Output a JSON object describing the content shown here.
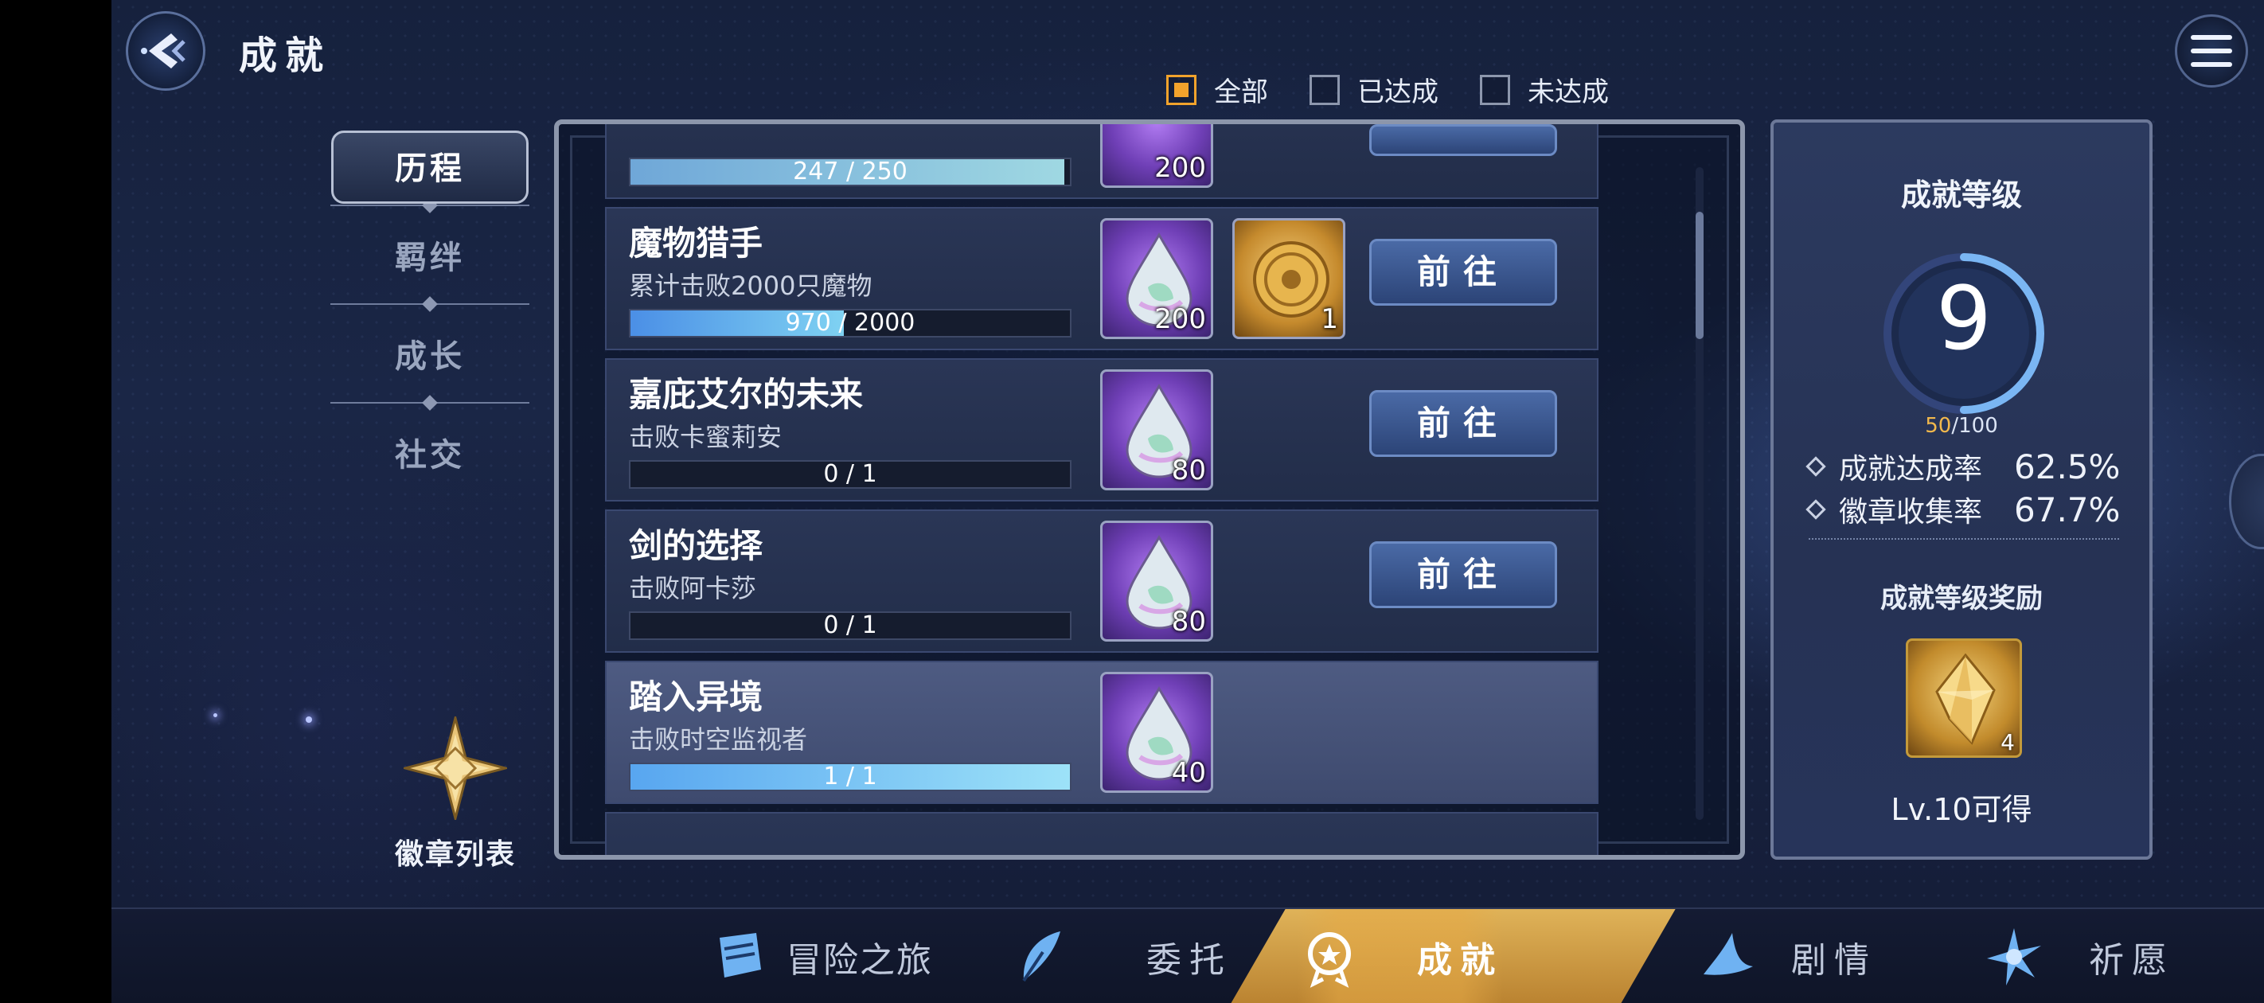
{
  "header": {
    "title": "成就"
  },
  "filters": [
    {
      "label": "全部",
      "checked": true
    },
    {
      "label": "已达成",
      "checked": false
    },
    {
      "label": "未达成",
      "checked": false
    }
  ],
  "categories": [
    {
      "label": "历程",
      "active": true
    },
    {
      "label": "羁绊",
      "active": false
    },
    {
      "label": "成长",
      "active": false
    },
    {
      "label": "社交",
      "active": false
    }
  ],
  "badge_list": {
    "label": "徽章列表"
  },
  "achievements": {
    "partial_top": {
      "progress_text": "247 / 250",
      "progress": 0.988,
      "reward_count": "200"
    },
    "items": [
      {
        "name": "魔物猎手",
        "desc": "累计击败2000只魔物",
        "progress_text": "970 / 2000",
        "progress": 0.485,
        "rewards": [
          {
            "icon": "crystal-drop-icon",
            "count": "200"
          },
          {
            "icon": "gold-coin-icon",
            "count": "1"
          }
        ],
        "button": "前往",
        "done": false
      },
      {
        "name": "嘉庇艾尔的未来",
        "desc": "击败卡蜜莉安",
        "progress_text": "0 / 1",
        "progress": 0,
        "rewards": [
          {
            "icon": "crystal-drop-icon",
            "count": "80"
          }
        ],
        "button": "前往",
        "done": false
      },
      {
        "name": "剑的选择",
        "desc": "击败阿卡莎",
        "progress_text": "0 / 1",
        "progress": 0,
        "rewards": [
          {
            "icon": "crystal-drop-icon",
            "count": "80"
          }
        ],
        "button": "前往",
        "done": false
      },
      {
        "name": "踏入异境",
        "desc": "击败时空监视者",
        "progress_text": "1 / 1",
        "progress": 1,
        "rewards": [
          {
            "icon": "crystal-drop-icon",
            "count": "40"
          }
        ],
        "button": "",
        "done": true
      }
    ]
  },
  "level_panel": {
    "title": "成就等级",
    "level": "9",
    "exp_current": "50",
    "exp_total": "/100",
    "exp_progress": 0.5,
    "stats": [
      {
        "label": "成就达成率",
        "value": "62.5%"
      },
      {
        "label": "徽章收集率",
        "value": "67.7%"
      }
    ],
    "reward_title": "成就等级奖励",
    "reward_count": "4",
    "reward_note": "Lv.10可得"
  },
  "bottom_nav": [
    {
      "label": "冒险之旅",
      "icon": "scroll-map-icon",
      "active": false
    },
    {
      "label": "委托",
      "icon": "feather-quill-icon",
      "active": false
    },
    {
      "label": "成就",
      "icon": "medal-icon",
      "active": true
    },
    {
      "label": "剧情",
      "icon": "wizard-hat-icon",
      "active": false
    },
    {
      "label": "祈愿",
      "icon": "star-burst-icon",
      "active": false
    }
  ],
  "colors": {
    "accent_gold": "#f2a32c",
    "progress_blue": "#4b8fe6",
    "button_blue": "#3a5a92"
  }
}
